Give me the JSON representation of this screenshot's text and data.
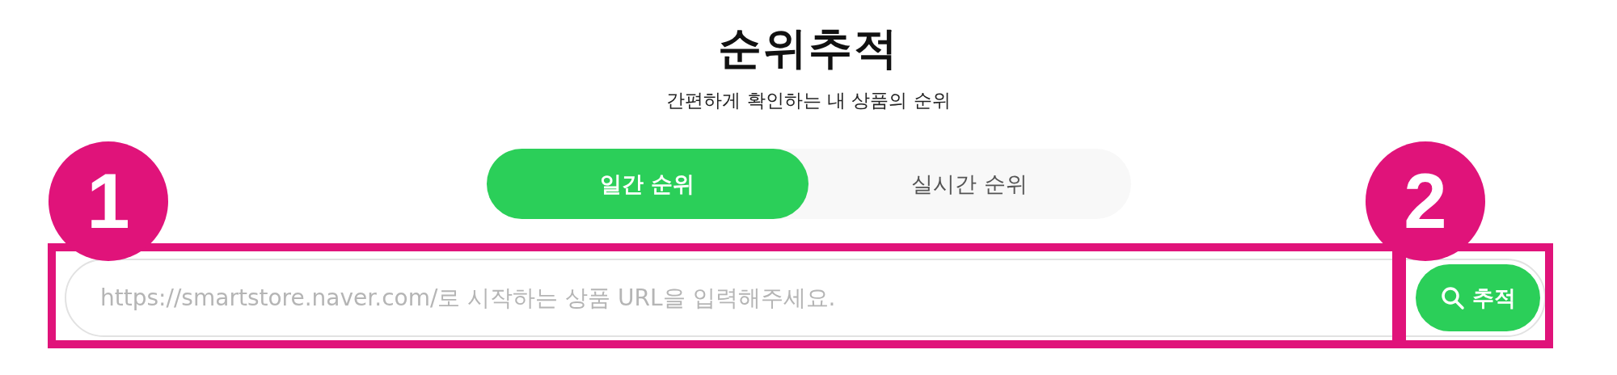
{
  "title": "순위추적",
  "subtitle": "간편하게 확인하는 내 상품의 순위",
  "tabs": [
    {
      "label": "일간 순위",
      "selected": true
    },
    {
      "label": "실시간 순위",
      "selected": false
    }
  ],
  "search": {
    "placeholder": "https://smartstore.naver.com/로 시작하는 상품 URL을 입력해주세요.",
    "button": "추적"
  },
  "annotations": [
    {
      "label": "1",
      "kind": "field"
    },
    {
      "label": "2",
      "kind": "button"
    }
  ]
}
